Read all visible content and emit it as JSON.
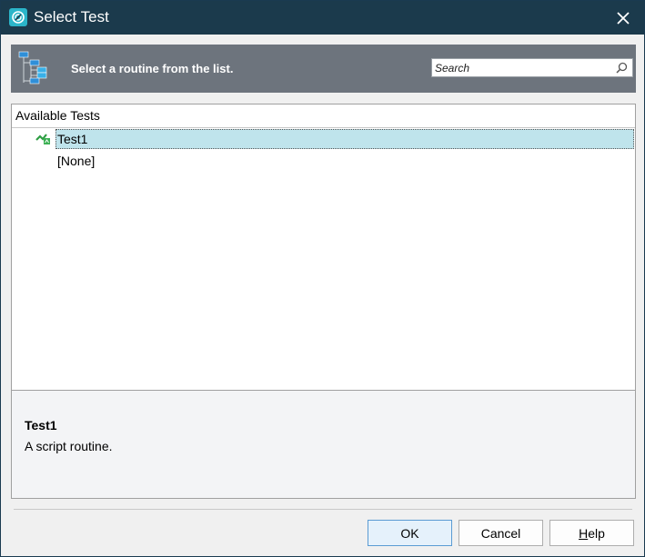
{
  "window": {
    "title": "Select Test"
  },
  "header": {
    "instruction": "Select a routine from the list.",
    "search": {
      "placeholder": "Search",
      "value": ""
    }
  },
  "list": {
    "column_header": "Available Tests",
    "items": [
      {
        "label": "Test1",
        "icon": "script-routine-icon",
        "selected": true
      },
      {
        "label": "[None]",
        "icon": "",
        "selected": false
      }
    ]
  },
  "description": {
    "title": "Test1",
    "text": "A script routine."
  },
  "buttons": {
    "ok": "OK",
    "cancel": "Cancel",
    "help_first": "H",
    "help_rest": "elp"
  },
  "colors": {
    "titlebar": "#1b3a4c",
    "header_band": "#6d747d",
    "selection": "#bfe4ec",
    "accent": "#2bb5c9"
  }
}
